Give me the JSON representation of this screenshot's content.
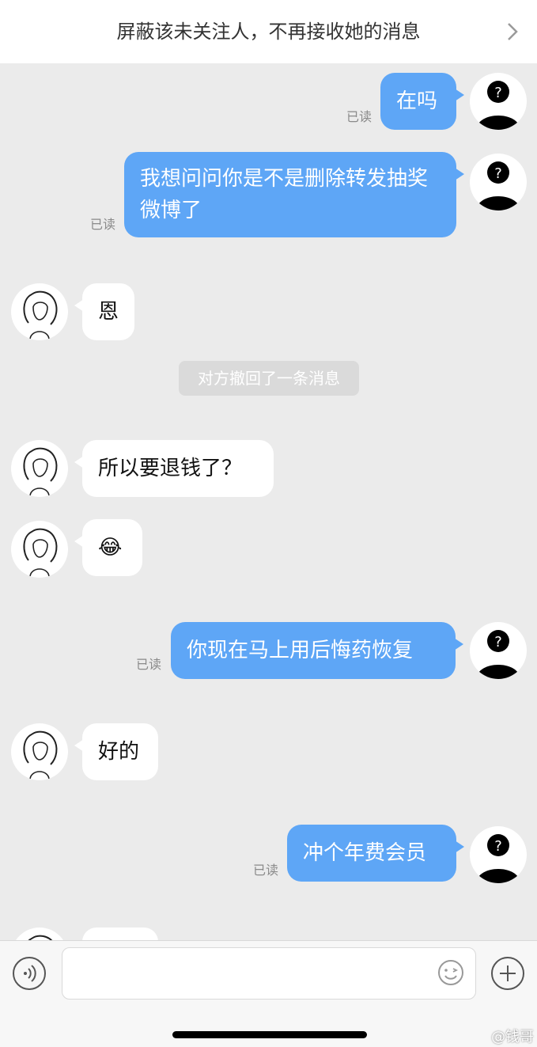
{
  "header": {
    "text": "屏蔽该未关注人，不再接收她的消息"
  },
  "messages": [
    {
      "side": "right",
      "text": "在吗",
      "read": "已读"
    },
    {
      "side": "right",
      "text": "我想问问你是不是删除转发抽奖微博了",
      "read": "已读"
    },
    {
      "side": "left",
      "text": "恩"
    },
    {
      "side": "system",
      "text": "对方撤回了一条消息"
    },
    {
      "side": "left",
      "text": "所以要退钱了？"
    },
    {
      "side": "left",
      "emoji": "😂"
    },
    {
      "side": "right",
      "text": "你现在马上用后悔药恢复",
      "read": "已读"
    },
    {
      "side": "left",
      "text": "好的"
    },
    {
      "side": "right",
      "text": "冲个年费会员",
      "read": "已读"
    }
  ],
  "watermark": "@钱哥"
}
